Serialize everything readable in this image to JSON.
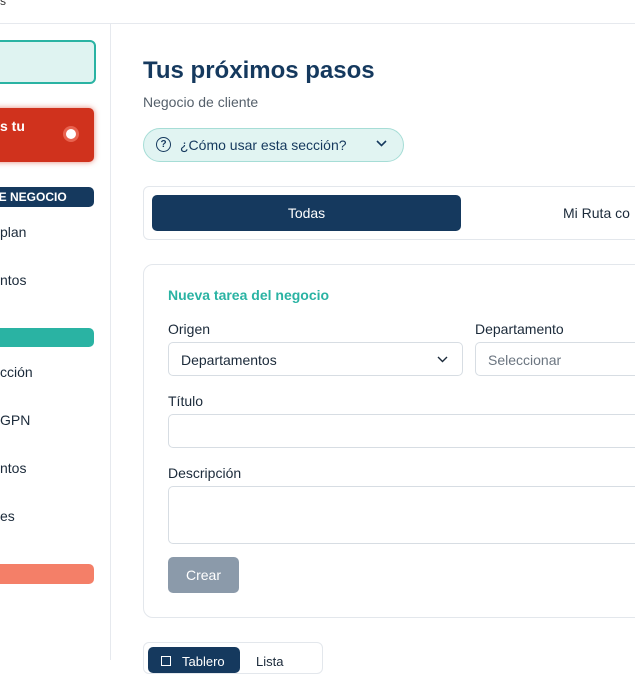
{
  "topbar": {
    "fragment": "s"
  },
  "sidebar": {
    "alert_text": "s tu",
    "section_label": "DE NEGOCIO",
    "items": [
      {
        "label": "plan"
      },
      {
        "label": "ntos"
      },
      {
        "label": "cción"
      },
      {
        "label": "GPN"
      },
      {
        "label": "ntos"
      },
      {
        "label": "es"
      }
    ]
  },
  "header": {
    "title": "Tus próximos pasos",
    "subtitle": "Negocio de cliente",
    "help_label": "¿Cómo usar esta sección?"
  },
  "tabs": {
    "active": "Todas",
    "other": "Mi Ruta co"
  },
  "form": {
    "title": "Nueva tarea del negocio",
    "origen_label": "Origen",
    "origen_value": "Departamentos",
    "departamento_label": "Departamento",
    "departamento_placeholder": "Seleccionar",
    "titulo_label": "Título",
    "titulo_value": "",
    "descripcion_label": "Descripción",
    "descripcion_value": "",
    "create_label": "Crear"
  },
  "view_toggle": {
    "active": "Tablero",
    "other": "Lista"
  },
  "colors": {
    "navy": "#15395e",
    "teal": "#2ab3a3",
    "alert_red": "#d0321d",
    "salmon": "#f47f68",
    "disabled_button": "#8b9aaa"
  }
}
